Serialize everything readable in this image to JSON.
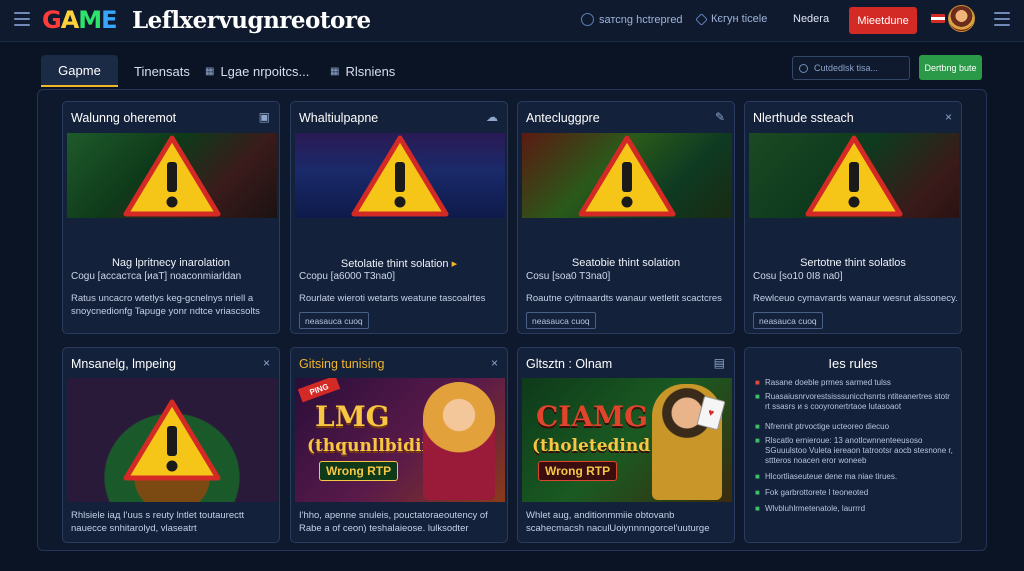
{
  "header": {
    "logo": [
      "G",
      "A",
      "M",
      "E"
    ],
    "title": "Leflxerᴠugnreotore",
    "links": [
      "sатсng hctrepred",
      "Кєгун ticele",
      "Nedera"
    ],
    "cta": "Mieetdune"
  },
  "tabs": [
    {
      "label": "Gapme"
    },
    {
      "label": "Tinensats"
    },
    {
      "label": "Lgae nrpoitcs..."
    },
    {
      "label": "Rlsniens"
    }
  ],
  "toolbar": {
    "search_placeholder": "Сutdedlsk tisa...",
    "action_label": "Dertbng bute"
  },
  "cards": [
    {
      "title": "Walunng oheremot",
      "info_title": "Nag lpritnecy inarolation",
      "info_sub": "Cogu [ассастса [иаТ] noaconmiarldan",
      "desc": "Ratus uncacro wtetlys keg-gcnelnys nriell a snoycnedionfg Tapuge yonr ndtce vriascsolts",
      "tag": ""
    },
    {
      "title": "Whaltiulpapne",
      "info_title": "Setolatie thint solation",
      "info_sub": "Ccopu [a6000 T3na0]",
      "desc": "Rourlate wieroti wetarts weatune tascoalrtes",
      "tag": "neasauca cuoq"
    },
    {
      "title": "Antecluggpre",
      "info_title": "Seatobie thint solation",
      "info_sub": "Cosu [soa0 T3na0]",
      "desc": "Roautne cyitmaardts wanaur wetletit scactcres",
      "tag": "neasauca cuoq"
    },
    {
      "title": "Nlerthude ssteach",
      "info_title": "Sertotne thint solatlos",
      "info_sub": "Cosu [so10 0I8 na0]",
      "desc": "Rewlceuo cymavrards wanaur wesrut alssonecy.",
      "tag": "neasauca cuoq"
    },
    {
      "title": "Mnsanelg, lmpeing",
      "desc": "Rhlsiele iaд I'uus s reuty lntlet toutaurectt nauecce snhitarolyd, vlaseatrt"
    },
    {
      "title": "Gitsing tunising",
      "banner_top": "LMG",
      "banner_mid": "(thqunllbiding",
      "banner_btn": "Wrong RTP",
      "badge": "PING",
      "desc": "I'hho, apenne snuleis, pouctatoraeoutency of Rabe a of ceon) teshalaieose. lulksodter"
    },
    {
      "title": "Gltsztn : Olnam",
      "banner_top": "CIAMG",
      "banner_mid": "(tholetedind",
      "banner_btn": "Wrong RTP",
      "desc": "Whlet aug, anditionmmiie obtovanb scahecmacsh naculUoiynnnngorcel'uuturge"
    }
  ],
  "rules": {
    "title": "Ies rules",
    "items": [
      {
        "text": "Rasane doeble prmes sarmed tulss",
        "color": "#e04a3a"
      },
      {
        "text": "Ruasaiusnrvorestsisssunicchsnrts ntiteanertres stotr rt ssasrs и s cooyronertrtaoe lutasoaot",
        "color": "#3fbf6b"
      },
      {
        "text": "Nfrennit ptrvoctige ucteoreo diecuo",
        "color": "#3fbf6b"
      },
      {
        "text": "Rlscatlo ernieroue: 13 anotlcwnnenteeusoso SGuuulstoo Vuleta iereaon tatrootsr aocb stesnone r, sttteros noacen eror woneeb",
        "color": "#3fbf6b"
      },
      {
        "text": "Hlcortliaseuteue dene ma niae tirues.",
        "color": "#3fbf6b"
      },
      {
        "text": "Fok garbrottorete l teoneoted",
        "color": "#3fbf6b"
      },
      {
        "text": "Wlvbluhlrmetenatole, laurrrd",
        "color": "#3fbf6b"
      }
    ]
  },
  "colors": {
    "accent": "#f1b52b",
    "danger": "#d42a25",
    "success": "#2b9a48",
    "background": "#0b1424"
  }
}
